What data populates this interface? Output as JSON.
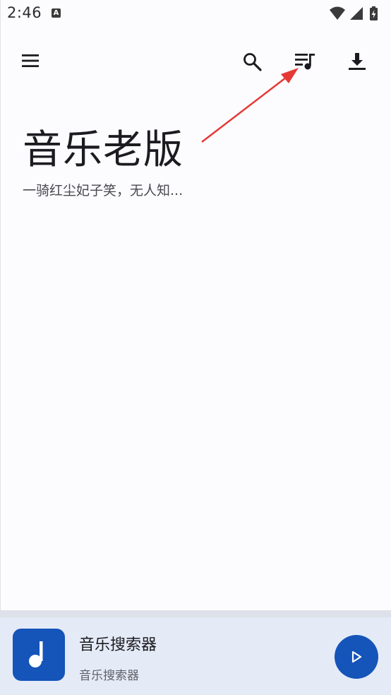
{
  "status_bar": {
    "time": "2:46",
    "notification_icon": "a-icon",
    "wifi_icon": "wifi-icon",
    "signal_icon": "signal-icon",
    "battery_icon": "battery-charging-icon"
  },
  "app_bar": {
    "menu_icon": "menu-icon",
    "search_icon": "search-icon",
    "playlist_icon": "queue-music-icon",
    "download_icon": "download-icon"
  },
  "header": {
    "title": "音乐老版",
    "subtitle": "一骑红尘妃子笑，无人知..."
  },
  "annotation": {
    "arrow_icon": "red-arrow-icon",
    "arrow_color": "#e53935"
  },
  "player": {
    "art_icon": "music-note-icon",
    "title": "音乐搜索器",
    "subtitle": "音乐搜索器",
    "play_icon": "play-icon"
  },
  "colors": {
    "accent": "#1554b9",
    "background": "#fcfbfe",
    "player_background": "#e4ebf7"
  }
}
